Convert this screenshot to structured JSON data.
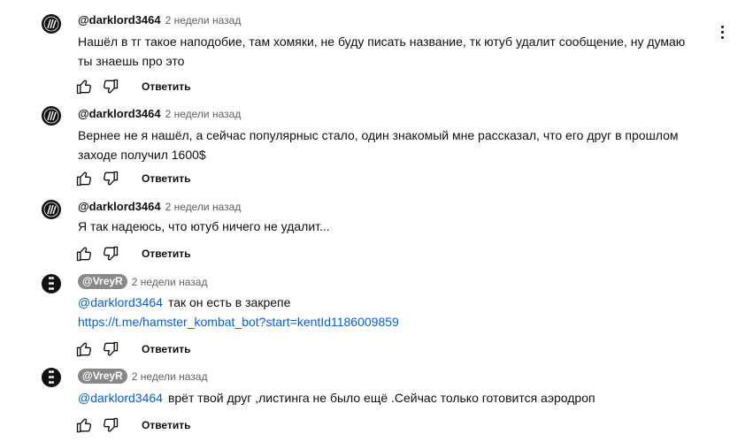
{
  "comments": [
    {
      "author": "@darklord3464",
      "time": "2 недели назад",
      "avatar_icon": "claw-logo-icon",
      "text": "Нашёл в тг такое наподобие, там хомяки, не буду писать название, тк ютуб удалит сообщение, ну думаю ты знаешь про это",
      "reply_label": "Ответить"
    },
    {
      "author": "@darklord3464",
      "time": "2 недели назад",
      "avatar_icon": "claw-logo-icon",
      "text": "Вернее не я нашёл, а сейчас популярныс стало, один знакомый мне рассказал, что его друг в прошлом заходе получил 1600$",
      "reply_label": "Ответить"
    },
    {
      "author": "@darklord3464",
      "time": "2 недели назад",
      "avatar_icon": "claw-logo-icon",
      "text": "Я так надеюсь, что ютуб ничего не удалит...",
      "reply_label": "Ответить"
    },
    {
      "author": "@VreyR",
      "time": "2 недели назад",
      "avatar_icon": "dots-pattern-icon",
      "mention": "@darklord3464",
      "text": "так он есть в закрепе",
      "link": "https://t.me/hamster_kombat_bot?start=kentId1186009859",
      "reply_label": "Ответить"
    },
    {
      "author": "@VreyR",
      "time": "2 недели назад",
      "avatar_icon": "dots-pattern-icon",
      "mention": "@darklord3464",
      "text": "врёт твой друг ,листинга не было ещё .Сейчас только готовится аэродроп",
      "reply_label": "Ответить"
    }
  ],
  "menu_icon": "more-vert-icon",
  "colors": {
    "link": "#065fd4",
    "secondary_text": "#606060",
    "author_chip": "#888888"
  }
}
